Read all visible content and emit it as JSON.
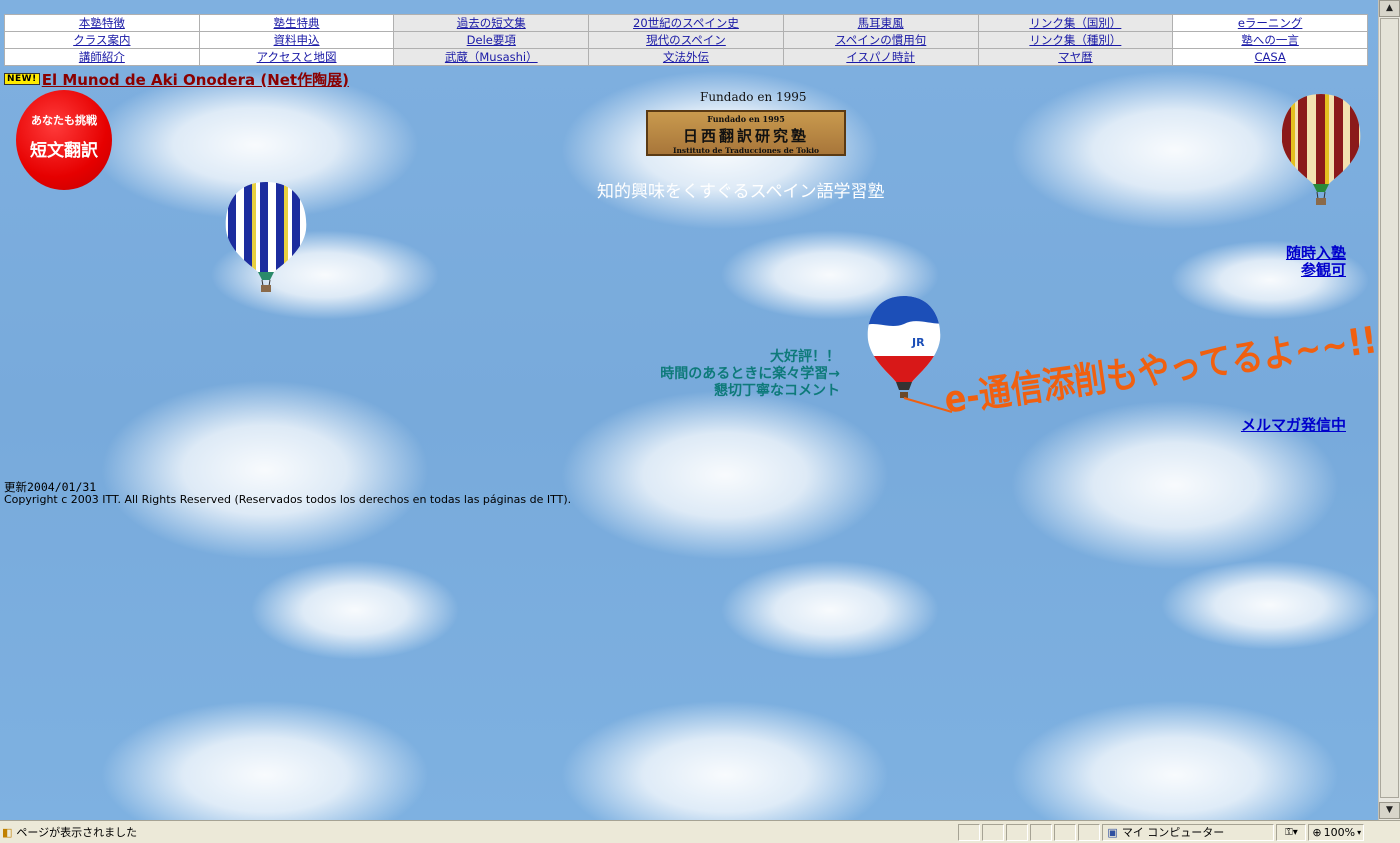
{
  "nav": {
    "rows": [
      [
        "本塾特徴",
        "塾生特典",
        "過去の短文集",
        "20世紀のスペイン史",
        "馬耳東風",
        "リンク集（国別）",
        "eラーニング"
      ],
      [
        "クラス案内",
        "資料申込",
        "Dele要項",
        "現代のスペイン",
        "スペインの慣用句",
        "リンク集（種別）",
        "塾への一言"
      ],
      [
        "講師紹介",
        "アクセスと地図",
        "武蔵（Musashi）",
        "文法外伝",
        "イスパノ時計",
        "マヤ暦",
        "CASA"
      ]
    ]
  },
  "news": {
    "badge": "NEW!",
    "link": "El Munod de Aki Onodera (Net作陶展)"
  },
  "challenge": {
    "line1": "あなたも挑戦",
    "line2": "短文翻訳"
  },
  "header": {
    "fundado": "Fundado en 1995",
    "logo_line1": "Fundado en 1995",
    "logo_line2": "日西翻訳研究塾",
    "logo_line3": "Instituto de Traducciones de Tokio",
    "tagline": "知的興味をくすぐるスペイン語学習塾"
  },
  "balloons": {
    "jr_label": "JR"
  },
  "recruit": {
    "line1": "随時入塾",
    "line2": "参観可"
  },
  "promo": {
    "line1": "大好評！！",
    "line2": "時間のあるときに楽々学習→",
    "line3": "懇切丁寧なコメント"
  },
  "correspondence": "e-通信添削もやってるよ~~!!",
  "mailmag": "メルマガ発信中",
  "footer": {
    "update": "更新2004/01/31",
    "copyright": "Copyright c 2003 ITT. All Rights Reserved (Reservados todos los derechos en todas las páginas de ITT)."
  },
  "statusbar": {
    "status": "ページが表示されました",
    "zone": "マイ コンピューター",
    "zoom": "100%"
  }
}
